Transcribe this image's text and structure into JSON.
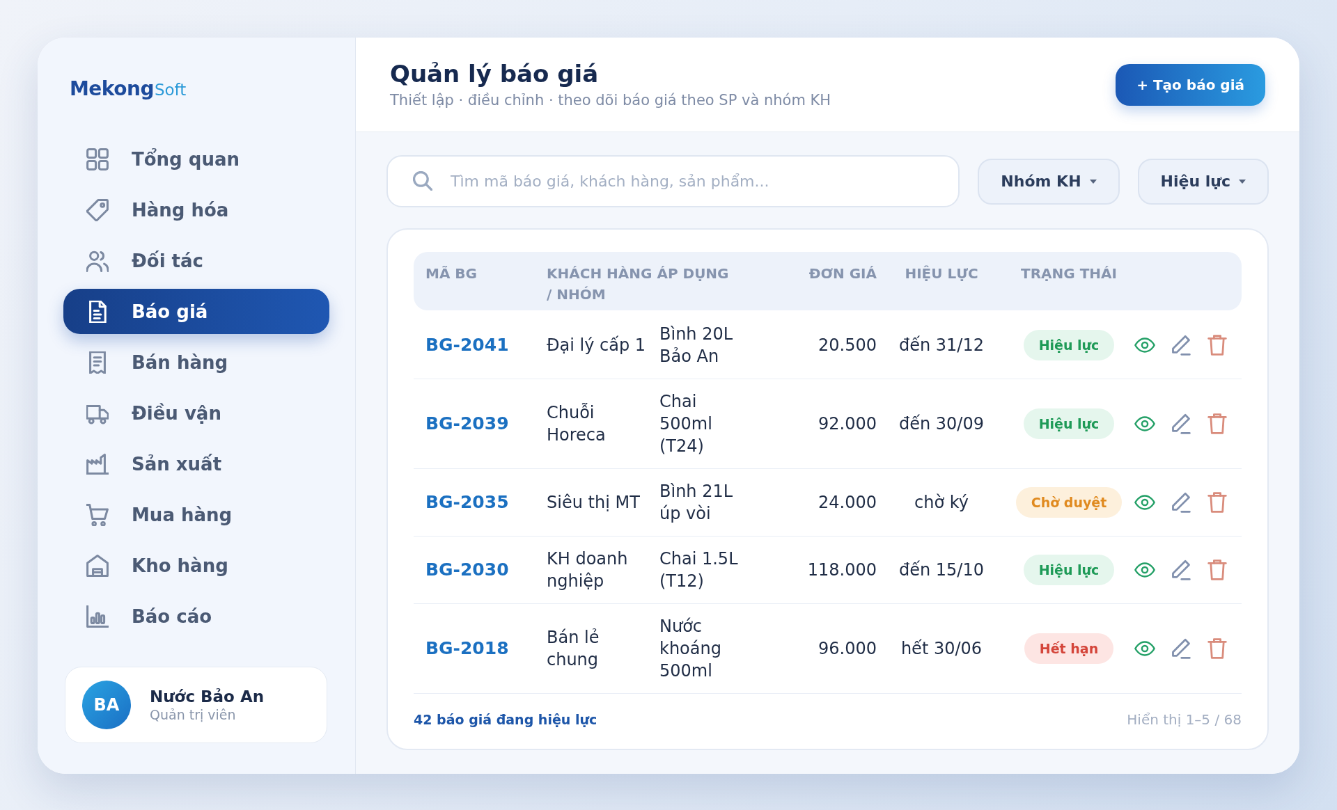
{
  "sidebar": {
    "logo": {
      "primary": "Mekong",
      "secondary": "Soft"
    },
    "items": [
      {
        "label": "Tổng quan",
        "selected": false
      },
      {
        "label": "Hàng hóa",
        "selected": false
      },
      {
        "label": "Đối tác",
        "selected": false
      },
      {
        "label": "Báo giá",
        "selected": true
      },
      {
        "label": "Bán hàng",
        "selected": false
      },
      {
        "label": "Điều vận",
        "selected": false
      },
      {
        "label": "Sản xuất",
        "selected": false
      },
      {
        "label": "Mua hàng",
        "selected": false
      },
      {
        "label": "Kho hàng",
        "selected": false
      },
      {
        "label": "Báo cáo",
        "selected": false
      }
    ],
    "user": {
      "initials": "BA",
      "name": "Nước Bảo An",
      "role": "Quản trị viên"
    }
  },
  "header": {
    "title": "Quản lý báo giá",
    "subtitle": "Thiết lập · điều chỉnh · theo dõi báo giá theo SP và nhóm KH",
    "action": "+ Tạo báo giá"
  },
  "toolbar": {
    "search": {
      "placeholder": "Tìm mã báo giá, khách hàng, sản phẩm..."
    },
    "filters": [
      {
        "label": "Nhóm KH"
      },
      {
        "label": "Hiệu lực"
      }
    ]
  },
  "table": {
    "columns": [
      "MÃ BG",
      "KHÁCH HÀNG ÁP DỤNG / NHÓM",
      "ĐƠN GIÁ",
      "HIỆU LỰC",
      "TRẠNG THÁI"
    ],
    "rows": [
      {
        "code": "BG-2041",
        "customer": "Đại lý cấp 1",
        "product": "Bình 20L Bảo An",
        "price": "20.500",
        "validity": "đến 31/12",
        "status": {
          "label": "Hiệu lực",
          "kind": "active"
        }
      },
      {
        "code": "BG-2039",
        "customer": "Chuỗi Horeca",
        "product": "Chai 500ml (T24)",
        "price": "92.000",
        "validity": "đến 30/09",
        "status": {
          "label": "Hiệu lực",
          "kind": "active"
        }
      },
      {
        "code": "BG-2035",
        "customer": "Siêu thị MT",
        "product": "Bình 21L úp vòi",
        "price": "24.000",
        "validity": "chờ ký",
        "status": {
          "label": "Chờ duyệt",
          "kind": "pending"
        }
      },
      {
        "code": "BG-2030",
        "customer": "KH doanh nghiệp",
        "product": "Chai 1.5L (T12)",
        "price": "118.000",
        "validity": "đến 15/10",
        "status": {
          "label": "Hiệu lực",
          "kind": "active"
        }
      },
      {
        "code": "BG-2018",
        "customer": "Bán lẻ chung",
        "product": "Nước khoáng 500ml",
        "price": "96.000",
        "validity": "hết 30/06",
        "status": {
          "label": "Hết hạn",
          "kind": "expired"
        }
      }
    ],
    "footer": {
      "summary": "42 báo giá đang hiệu lực",
      "pagination": "Hiển thị 1–5 / 68"
    }
  }
}
